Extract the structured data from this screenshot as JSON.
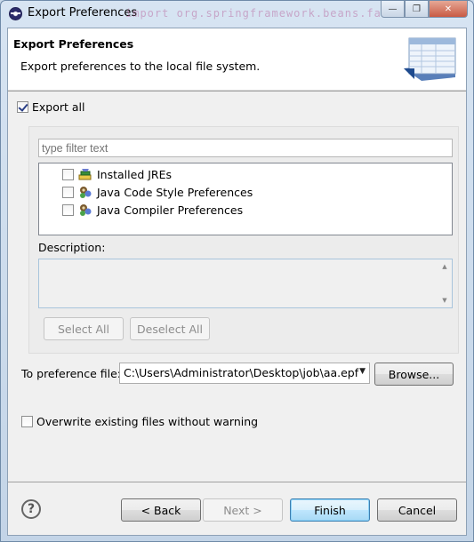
{
  "window": {
    "title": "Export Preferences",
    "background_code_text": "import org.springframework.beans.fa"
  },
  "header": {
    "title": "Export Preferences",
    "description": "Export preferences to the local file system."
  },
  "export_all": {
    "label": "Export all",
    "checked": true
  },
  "filter": {
    "placeholder": "type filter text",
    "value": ""
  },
  "tree": {
    "items": [
      {
        "label": "Installed JREs",
        "checked": false,
        "icon": "jre-icon"
      },
      {
        "label": "Java Code Style Preferences",
        "checked": false,
        "icon": "java-preferences-icon"
      },
      {
        "label": "Java Compiler Preferences",
        "checked": false,
        "icon": "java-preferences-icon"
      }
    ]
  },
  "description_label": "Description:",
  "buttons": {
    "select_all": "Select All",
    "deselect_all": "Deselect All",
    "browse": "Browse...",
    "back": "< Back",
    "next": "Next >",
    "finish": "Finish",
    "cancel": "Cancel",
    "help": "?"
  },
  "preference_file": {
    "label": "To preference file:",
    "value": "C:\\Users\\Administrator\\Desktop\\job\\aa.epf"
  },
  "overwrite": {
    "label": "Overwrite existing files without warning",
    "checked": false
  }
}
